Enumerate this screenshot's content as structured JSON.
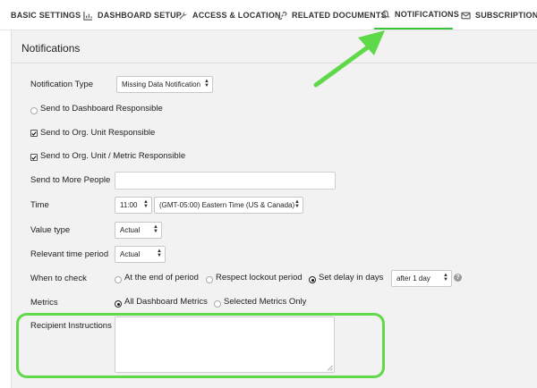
{
  "tabs": [
    {
      "label": "BASIC SETTINGS",
      "icon": "none"
    },
    {
      "label": "DASHBOARD SETUP",
      "icon": "bar-chart-icon"
    },
    {
      "label": "ACCESS & LOCATION",
      "icon": "wrench-icon"
    },
    {
      "label": "RELATED DOCUMENTS",
      "icon": "link-icon"
    },
    {
      "label": "NOTIFICATIONS",
      "icon": "bell-icon",
      "active": true
    },
    {
      "label": "SUBSCRIPTIONS",
      "icon": "envelope-icon"
    }
  ],
  "panel": {
    "title": "Notifications"
  },
  "form": {
    "notification_type": {
      "label": "Notification Type",
      "value": "Missing Data Notification"
    },
    "send_to_dashboard_responsible": {
      "label": "Send to Dashboard Responsible",
      "checked": false
    },
    "send_to_org_unit_responsible": {
      "label": "Send to Org. Unit Responsible",
      "checked": true
    },
    "send_to_org_unit_metric_responsible": {
      "label": "Send to Org. Unit / Metric Responsible",
      "checked": true
    },
    "send_to_more_people": {
      "label": "Send to More People",
      "value": ""
    },
    "time": {
      "label": "Time",
      "hour": "11:00",
      "timezone": "(GMT-05:00) Eastern Time (US & Canada)"
    },
    "value_type": {
      "label": "Value type",
      "value": "Actual"
    },
    "relevant_time_period": {
      "label": "Relevant time period",
      "value": "Actual"
    },
    "when_to_check": {
      "label": "When to check",
      "options": [
        "At the end of period",
        "Respect lockout period",
        "Set delay in days"
      ],
      "selected": "Set delay in days",
      "delay": "after 1 day"
    },
    "metrics": {
      "label": "Metrics",
      "options": [
        "All Dashboard Metrics",
        "Selected Metrics Only"
      ],
      "selected": "All Dashboard Metrics"
    },
    "recipient_instructions": {
      "label": "Recipient Instructions",
      "value": ""
    }
  },
  "colors": {
    "accent": "#3cc43c",
    "highlight": "#5fd84a",
    "panel_bg": "#f2f2f2"
  }
}
